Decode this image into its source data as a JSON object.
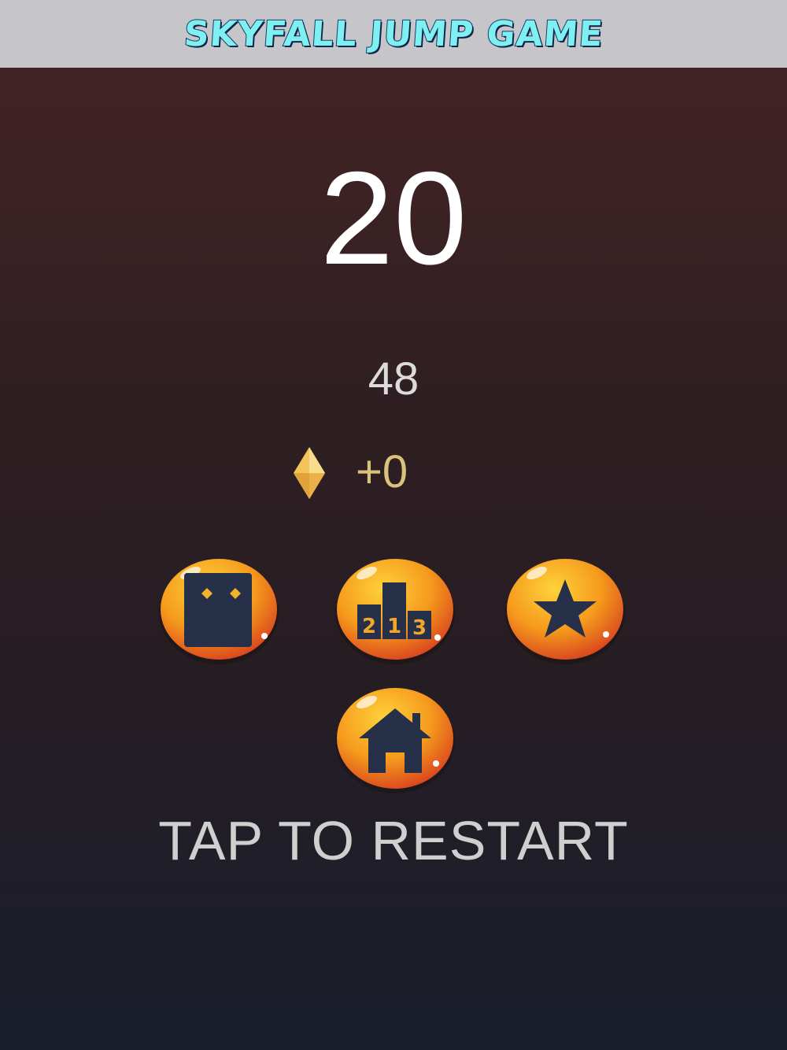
{
  "app_title": "SKYFALL JUMP GAME",
  "score": "20",
  "best_score": "48",
  "gems": "+0",
  "buttons": [
    {
      "icon": "character-icon"
    },
    {
      "icon": "leaderboard-icon",
      "podium": [
        "2",
        "1",
        "3"
      ]
    },
    {
      "icon": "star-icon"
    },
    {
      "icon": "home-icon"
    }
  ],
  "restart_label": "TAP TO RESTART",
  "colors": {
    "title_fill": "#7ff0f2",
    "title_outline": "#173a66",
    "bg_top": "#432325",
    "bg_bottom": "#1a1e2c",
    "button_orange": "#f39a1c",
    "button_red": "#e0451f",
    "icon_dark": "#273049",
    "gem_gold": "#f3c35c"
  }
}
